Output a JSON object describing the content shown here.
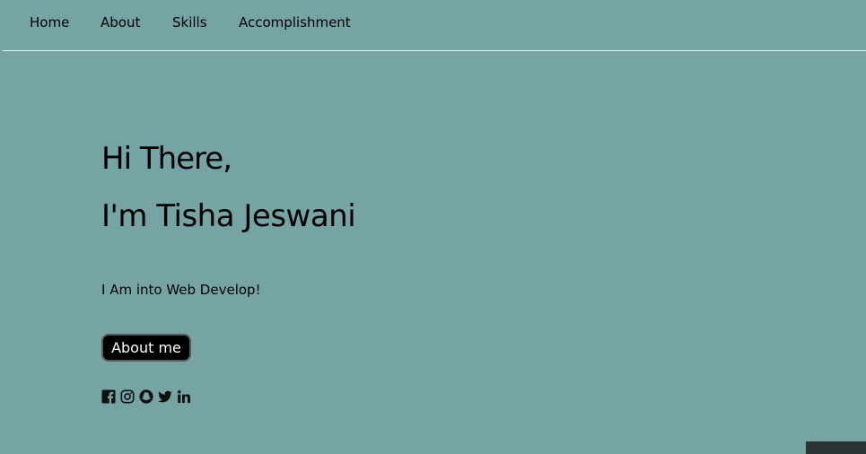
{
  "nav": {
    "items": [
      {
        "label": "Home"
      },
      {
        "label": "About"
      },
      {
        "label": "Skills"
      },
      {
        "label": "Accomplishment"
      }
    ]
  },
  "hero": {
    "greeting_line1": "Hi There,",
    "greeting_line2": "I'm Tisha Jeswani",
    "tagline": "I Am into Web Develop!",
    "button_label": "About me"
  },
  "social": {
    "icons": [
      "facebook-icon",
      "instagram-icon",
      "snapchat-icon",
      "twitter-icon",
      "linkedin-icon"
    ]
  },
  "colors": {
    "background": "#76a3a4",
    "button_bg": "#000000",
    "button_text": "#ffffff",
    "divider": "#e9f1f1",
    "corner_block": "#2b3434"
  }
}
